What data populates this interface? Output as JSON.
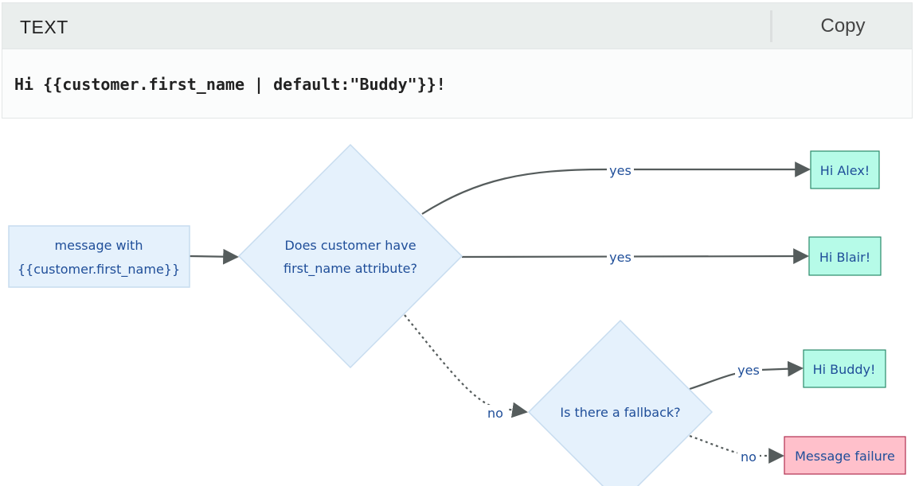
{
  "code_block": {
    "language_label": "TEXT",
    "copy_label": "Copy",
    "code": "Hi {{customer.first_name | default:\"Buddy\"}}!"
  },
  "flowchart": {
    "start_node": {
      "line1": "message with",
      "line2": "{{customer.first_name}}"
    },
    "decision_1": {
      "line1": "Does customer have",
      "line2": "first_name attribute?"
    },
    "decision_2": {
      "label": "Is there a fallback?"
    },
    "outcome_alex": {
      "label": "Hi Alex!"
    },
    "outcome_blair": {
      "label": "Hi Blair!"
    },
    "outcome_buddy": {
      "label": "Hi Buddy!"
    },
    "outcome_failure": {
      "label": "Message failure"
    },
    "edges": {
      "yes_alex": "yes",
      "yes_blair": "yes",
      "no_fallback": "no",
      "yes_buddy": "yes",
      "no_failure": "no"
    },
    "colors": {
      "node_fill": "#e5f1fc",
      "node_stroke": "#c7dcef",
      "success_fill": "#b6fbe8",
      "success_stroke": "#2a8a6a",
      "failure_fill": "#ffc0cb",
      "failure_stroke": "#b03050",
      "edge": "#555c5c",
      "label": "#1f4e99"
    }
  }
}
